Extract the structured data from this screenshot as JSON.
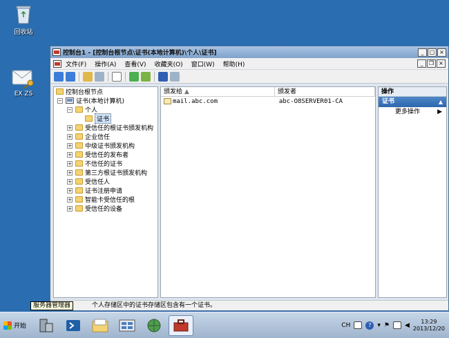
{
  "desktop": {
    "recycle_bin_label": "回收站",
    "user_icon_label": "EX ZS"
  },
  "window": {
    "title": "控制台1 - [控制台根节点\\证书(本地计算机)\\个人\\证书]",
    "menus": [
      "文件(F)",
      "操作(A)",
      "查看(V)",
      "收藏夹(O)",
      "窗口(W)",
      "帮助(H)"
    ],
    "tree": {
      "root": "控制台根节点",
      "certs": "证书(本地计算机)",
      "personal": "个人",
      "personal_certs": "证书",
      "stores": [
        "受信任的根证书颁发机构",
        "企业信任",
        "中级证书颁发机构",
        "受信任的发布者",
        "不信任的证书",
        "第三方根证书颁发机构",
        "受信任人",
        "证书注册申请",
        "智能卡受信任的根",
        "受信任的设备"
      ]
    },
    "list": {
      "columns": [
        "颁发给",
        "颁发者"
      ],
      "rows": [
        {
          "issued_to": "mail.abc.com",
          "issued_by": "abc-O8SERVER01-CA"
        }
      ]
    },
    "actions": {
      "title": "操作",
      "group": "证书",
      "item": "更多操作"
    },
    "status": "个人存储区中的证书存储区包含有一个证书。"
  },
  "tooltip": "服务器管理器",
  "taskbar": {
    "start_label": "开始",
    "lang": "CH",
    "time": "13:29",
    "date": "2013/12/20"
  }
}
